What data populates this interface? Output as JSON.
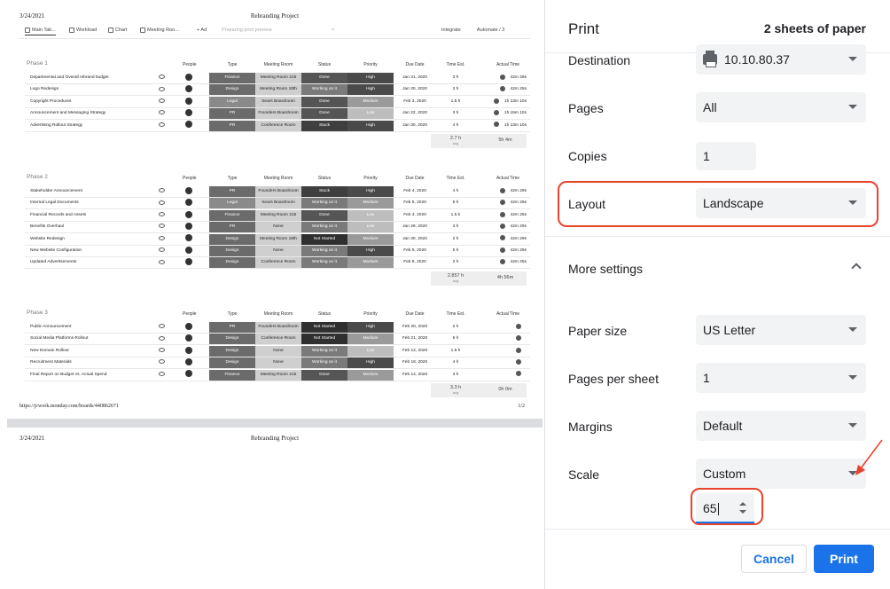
{
  "preview": {
    "page1": {
      "date": "3/24/2021",
      "title": "Rebranding Project",
      "url": "https://jcwork.monday.com/boards/440862671",
      "page_number": "1/2"
    },
    "page2": {
      "date": "3/24/2021",
      "title": "Rebranding Project"
    },
    "toolbar": {
      "tabs": [
        "Main Tab...",
        "Workload",
        "Chart",
        "Meeting Roo..."
      ],
      "add_label": "+ Ad",
      "preparing": "Preparing print preview",
      "close": "×",
      "integrate": "Integrate",
      "automate": "Automate / 3"
    },
    "columns": [
      "People",
      "Type",
      "Meeting Room",
      "Status",
      "Priority",
      "Due Date",
      "Time Est.",
      "Actual Time"
    ],
    "groups": [
      {
        "name": "Phase 1",
        "rows": [
          {
            "name": "Departmental and Overall rebrand budget",
            "type": "Finance",
            "room": "Meeting Room 215",
            "status": "Done",
            "priority": "High",
            "due": "Jan 31, 2020",
            "est": "3 h",
            "actual": "42m 29s"
          },
          {
            "name": "Logo Redesign",
            "type": "Design",
            "room": "Meeting Room 18th",
            "status": "Working on it",
            "priority": "High",
            "due": "Jan 30, 2020",
            "est": "2 h",
            "actual": "42m 25s"
          },
          {
            "name": "Copyright Procedures",
            "type": "Legal",
            "room": "Sears Boardroom",
            "status": "Done",
            "priority": "Medium",
            "due": "Feb 3, 2020",
            "est": "1.5 h",
            "actual": "1h 13m 10s"
          },
          {
            "name": "Announcement and Messaging Strategy",
            "type": "PR",
            "room": "Founders Boardroom",
            "status": "Done",
            "priority": "Low",
            "due": "Jan 22, 2020",
            "est": "3 h",
            "actual": "1h 15m 10s"
          },
          {
            "name": "Advertising Rollout Strategy",
            "type": "PR",
            "room": "Conference Room",
            "status": "Stuck",
            "priority": "High",
            "due": "Jan 30, 2020",
            "est": "4 h",
            "actual": "1h 13m 10s"
          }
        ],
        "sum_est": "2.7 h",
        "sum_sub": "avg",
        "sum_actual": "5h 4m"
      },
      {
        "name": "Phase 2",
        "rows": [
          {
            "name": "Stakeholder Announcement",
            "type": "PR",
            "room": "Founders Boardroom",
            "status": "Stuck",
            "priority": "High",
            "due": "Feb 4, 2020",
            "est": "4 h",
            "actual": "42m 29s"
          },
          {
            "name": "Internal Legal Documents",
            "type": "Legal",
            "room": "Sears Boardroom",
            "status": "Working on it",
            "priority": "Medium",
            "due": "Feb 5, 2020",
            "est": "5 h",
            "actual": "42m 29s"
          },
          {
            "name": "Financial Records and Assets",
            "type": "Finance",
            "room": "Meeting Room 215",
            "status": "Done",
            "priority": "Low",
            "due": "Feb 3, 2020",
            "est": "1.5 h",
            "actual": "42m 25s"
          },
          {
            "name": "Benefits Overhaul",
            "type": "PR",
            "room": "None",
            "status": "Working on it",
            "priority": "Low",
            "due": "Jan 29, 2020",
            "est": "3 h",
            "actual": "42m 29s"
          },
          {
            "name": "Website Redesign",
            "type": "Design",
            "room": "Meeting Room 18th",
            "status": "Not Started",
            "priority": "Medium",
            "due": "Jan 30, 2020",
            "est": "2 h",
            "actual": "42m 29s"
          },
          {
            "name": "New Website Configuration",
            "type": "Design",
            "room": "None",
            "status": "Working on it",
            "priority": "High",
            "due": "Feb 5, 2020",
            "est": "5 h",
            "actual": "42m 29s"
          },
          {
            "name": "Updated Advertisements",
            "type": "Design",
            "room": "Conference Room",
            "status": "Working on it",
            "priority": "Medium",
            "due": "Feb 6, 2020",
            "est": "2 h",
            "actual": "42m 25s"
          }
        ],
        "sum_est": "2.857 h",
        "sum_sub": "avg",
        "sum_actual": "4h 56m"
      },
      {
        "name": "Phase 3",
        "rows": [
          {
            "name": "Public Announcement",
            "type": "PR",
            "room": "Founders Boardroom",
            "status": "Not Started",
            "priority": "High",
            "due": "Feb 20, 2020",
            "est": "2 h",
            "actual": ""
          },
          {
            "name": "Social Media Platforms Rollout",
            "type": "Design",
            "room": "Conference Room",
            "status": "Not Started",
            "priority": "Medium",
            "due": "Feb 21, 2020",
            "est": "5 h",
            "actual": ""
          },
          {
            "name": "New Domain Rollout",
            "type": "Design",
            "room": "None",
            "status": "Working on it",
            "priority": "Low",
            "due": "Feb 12, 2020",
            "est": "1.5 h",
            "actual": ""
          },
          {
            "name": "Recruitment Materials",
            "type": "Design",
            "room": "None",
            "status": "Working on it",
            "priority": "High",
            "due": "Feb 18, 2020",
            "est": "4 h",
            "actual": ""
          },
          {
            "name": "Final Report on Budget vs. Actual Spend",
            "type": "Finance",
            "room": "Meeting Room 215",
            "status": "Done",
            "priority": "Medium",
            "due": "Feb 14, 2020",
            "est": "3 h",
            "actual": ""
          }
        ],
        "sum_est": "3.3 h",
        "sum_sub": "avg",
        "sum_actual": "0h 0m"
      }
    ]
  },
  "settings": {
    "title": "Print",
    "sheets": "2 sheets of paper",
    "destination": {
      "label": "Destination",
      "value": "10.10.80.37"
    },
    "pages": {
      "label": "Pages",
      "value": "All"
    },
    "copies": {
      "label": "Copies",
      "value": "1"
    },
    "layout": {
      "label": "Layout",
      "value": "Landscape"
    },
    "more_settings": "More settings",
    "paper_size": {
      "label": "Paper size",
      "value": "US Letter"
    },
    "pages_per_sheet": {
      "label": "Pages per sheet",
      "value": "1"
    },
    "margins": {
      "label": "Margins",
      "value": "Default"
    },
    "scale": {
      "label": "Scale",
      "value": "Custom",
      "custom_value": "65"
    },
    "cancel": "Cancel",
    "print": "Print"
  },
  "colors": {
    "accent": "#1a73e8",
    "highlight": "#e8432d",
    "type_dark": "#6b6b6b",
    "type_mid": "#8a8a8a",
    "status_done": "#555555",
    "status_stuck": "#3f3f3f",
    "status_working": "#7a7a7a",
    "status_not_started": "#2f2f2f",
    "priority_high": "#4a4a4a",
    "priority_medium": "#9a9a9a",
    "priority_low": "#bdbdbd"
  }
}
